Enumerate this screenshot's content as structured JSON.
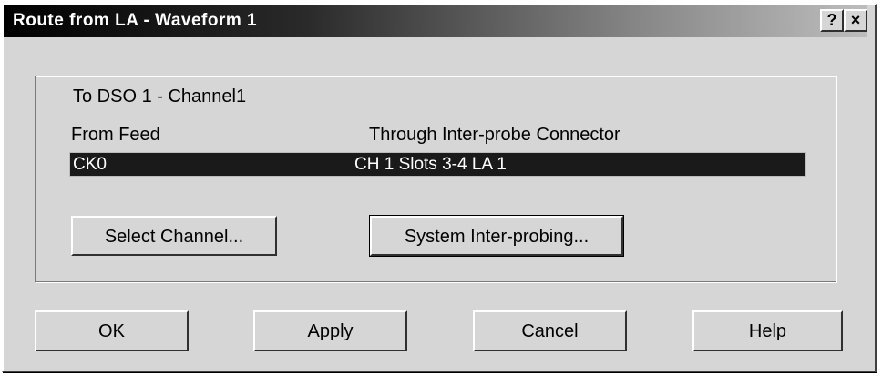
{
  "window": {
    "title": "Route from LA - Waveform 1",
    "help_button": "?",
    "close_button": "×"
  },
  "route": {
    "destination": "To DSO 1 - Channel1",
    "from_header": "From Feed",
    "through_header": "Through Inter-probe Connector",
    "selected_from": "CK0",
    "selected_through": "CH 1 Slots 3-4 LA 1"
  },
  "actions": {
    "select_channel": "Select Channel...",
    "system_interprobing": "System Inter-probing..."
  },
  "footer": {
    "ok": "OK",
    "apply": "Apply",
    "cancel": "Cancel",
    "help": "Help"
  },
  "colors": {
    "dialog_bg": "#d6d6d6",
    "selection_bg": "#1a1a1a",
    "title_text": "#ffffff"
  }
}
